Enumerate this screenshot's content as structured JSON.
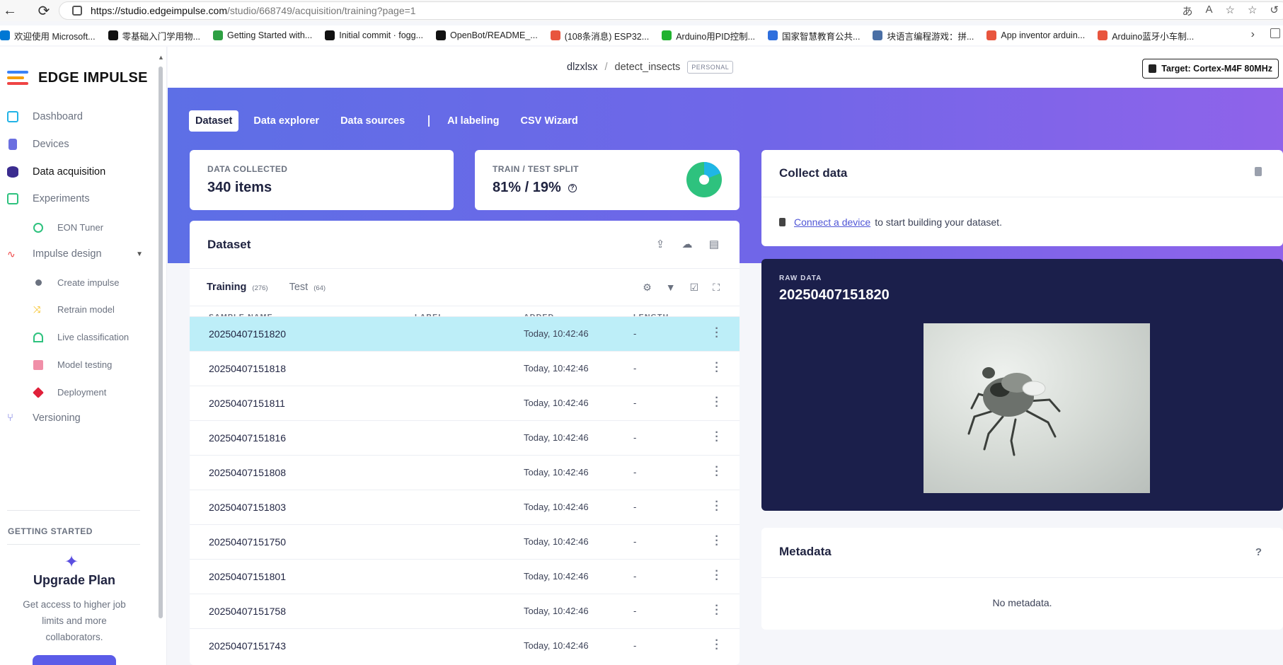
{
  "browser": {
    "url_host": "https://studio.edgeimpulse.com",
    "url_path": "/studio/668749/acquisition/training?page=1",
    "bookmarks": [
      {
        "label": "欢迎使用 Microsoft...",
        "color": "#0078d4"
      },
      {
        "label": "零基础入门学用物...",
        "color": "#111111"
      },
      {
        "label": "Getting Started with...",
        "color": "#2ea043"
      },
      {
        "label": "Initial commit · fogg...",
        "color": "#111111"
      },
      {
        "label": "OpenBot/README_...",
        "color": "#111111"
      },
      {
        "label": "(108条消息) ESP32...",
        "color": "#e8553e"
      },
      {
        "label": "Arduino用PID控制...",
        "color": "#20b22f"
      },
      {
        "label": "国家智慧教育公共...",
        "color": "#2f6fdd"
      },
      {
        "label": "块语言编程游戏：拼...",
        "color": "#4a6fa5"
      },
      {
        "label": "App inventor arduin...",
        "color": "#e8553e"
      },
      {
        "label": "Arduino蓝牙小车制...",
        "color": "#e8553e"
      }
    ]
  },
  "sidebar": {
    "logo_text": "EDGE IMPULSE",
    "items": [
      {
        "label": "Dashboard",
        "icon": "monitor-icon"
      },
      {
        "label": "Devices",
        "icon": "chip-icon"
      },
      {
        "label": "Data acquisition",
        "icon": "database-icon"
      },
      {
        "label": "Experiments",
        "icon": "table-icon"
      },
      {
        "label": "EON Tuner",
        "icon": "compass-icon"
      },
      {
        "label": "Impulse design",
        "icon": "pulse-icon"
      },
      {
        "label": "Create impulse",
        "icon": "dot-icon"
      },
      {
        "label": "Retrain model",
        "icon": "shuffle-icon"
      },
      {
        "label": "Live classification",
        "icon": "network-icon"
      },
      {
        "label": "Model testing",
        "icon": "clipboard-icon"
      },
      {
        "label": "Deployment",
        "icon": "cube-icon"
      },
      {
        "label": "Versioning",
        "icon": "branch-icon"
      }
    ],
    "getting_started": "GETTING STARTED",
    "upgrade_title": "Upgrade Plan",
    "upgrade_desc": "Get access to higher job limits and more collaborators."
  },
  "header": {
    "user": "dlzxlsx",
    "separator": "/",
    "project": "detect_insects",
    "badge": "PERSONAL",
    "target": "Target: Cortex-M4F 80MHz"
  },
  "tabs": [
    "Dataset",
    "Data explorer",
    "Data sources",
    "AI labeling",
    "CSV Wizard"
  ],
  "stats": {
    "collected_label": "DATA COLLECTED",
    "collected_value": "340 items",
    "split_label": "TRAIN / TEST SPLIT",
    "split_value": "81% / 19%",
    "train_fraction": 0.81
  },
  "dataset": {
    "title": "Dataset",
    "training_label": "Training",
    "training_count": "(276)",
    "test_label": "Test",
    "test_count": "(64)",
    "columns": [
      "SAMPLE NAME",
      "LABEL",
      "ADDED",
      "LENGTH"
    ],
    "rows": [
      {
        "name": "20250407151820",
        "label": "",
        "added": "Today, 10:42:46",
        "length": "-"
      },
      {
        "name": "20250407151818",
        "label": "",
        "added": "Today, 10:42:46",
        "length": "-"
      },
      {
        "name": "20250407151811",
        "label": "",
        "added": "Today, 10:42:46",
        "length": "-"
      },
      {
        "name": "20250407151816",
        "label": "",
        "added": "Today, 10:42:46",
        "length": "-"
      },
      {
        "name": "20250407151808",
        "label": "",
        "added": "Today, 10:42:46",
        "length": "-"
      },
      {
        "name": "20250407151803",
        "label": "",
        "added": "Today, 10:42:46",
        "length": "-"
      },
      {
        "name": "20250407151750",
        "label": "",
        "added": "Today, 10:42:46",
        "length": "-"
      },
      {
        "name": "20250407151801",
        "label": "",
        "added": "Today, 10:42:46",
        "length": "-"
      },
      {
        "name": "20250407151758",
        "label": "",
        "added": "Today, 10:42:46",
        "length": "-"
      },
      {
        "name": "20250407151743",
        "label": "",
        "added": "Today, 10:42:46",
        "length": "-"
      }
    ]
  },
  "collect": {
    "title": "Collect data",
    "link": "Connect a device",
    "text": "to start building your dataset."
  },
  "raw": {
    "label": "RAW DATA",
    "title": "20250407151820"
  },
  "metadata": {
    "title": "Metadata",
    "help": "?",
    "empty": "No metadata."
  },
  "colors": {
    "accent": "#5d6fe6",
    "selected_row": "#bdeef8",
    "pie_train": "#2ec27e",
    "pie_test": "#1fb6e6"
  }
}
